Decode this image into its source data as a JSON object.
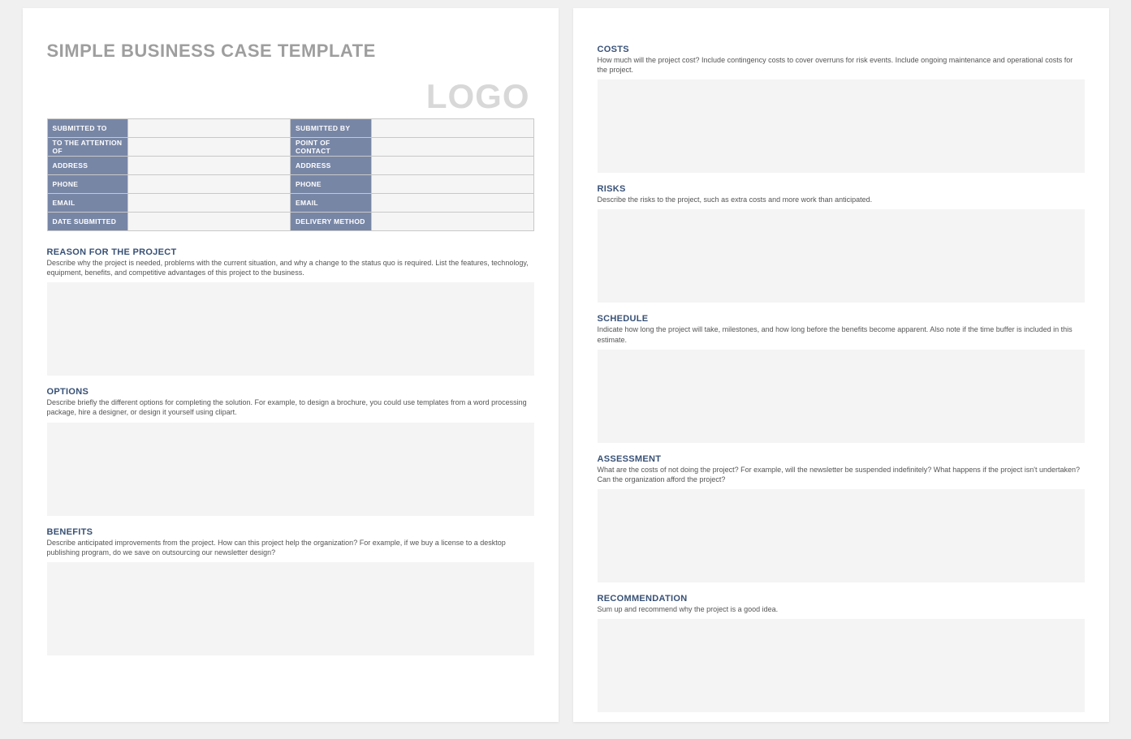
{
  "title": "SIMPLE BUSINESS CASE TEMPLATE",
  "logo": "LOGO",
  "infoTable": {
    "r1c1": "SUBMITTED TO",
    "r1c2": "SUBMITTED BY",
    "r2c1": "TO THE ATTENTION OF",
    "r2c2": "POINT OF CONTACT",
    "r3c1": "ADDRESS",
    "r3c2": "ADDRESS",
    "r4c1": "PHONE",
    "r4c2": "PHONE",
    "r5c1": "EMAIL",
    "r5c2": "EMAIL",
    "r6c1": "DATE SUBMITTED",
    "r6c2": "DELIVERY METHOD"
  },
  "sections": {
    "reason": {
      "title": "REASON FOR THE PROJECT",
      "desc": "Describe why the project is needed, problems with the current situation, and why a change to the status quo is required. List the features, technology, equipment, benefits, and competitive advantages of this project to the business."
    },
    "options": {
      "title": "OPTIONS",
      "desc": "Describe briefly the different options for completing the solution. For example, to design a brochure, you could use templates from a word processing package, hire a designer, or design it yourself using clipart."
    },
    "benefits": {
      "title": "BENEFITS",
      "desc": "Describe anticipated improvements from the project. How can this project help the organization? For example, if we buy a license to a desktop publishing program, do we save on outsourcing our newsletter design?"
    },
    "costs": {
      "title": "COSTS",
      "desc": "How much will the project cost? Include contingency costs to cover overruns for risk events. Include ongoing maintenance and operational costs for the project."
    },
    "risks": {
      "title": "RISKS",
      "desc": "Describe the risks to the project, such as extra costs and more work than anticipated."
    },
    "schedule": {
      "title": "SCHEDULE",
      "desc": "Indicate how long the project will take, milestones, and how long before the benefits become apparent. Also note if the time buffer is included in this estimate."
    },
    "assessment": {
      "title": "ASSESSMENT",
      "desc": "What are the costs of not doing the project? For example, will the newsletter be suspended indefinitely? What happens if the project isn't undertaken? Can the organization afford the project?"
    },
    "recommendation": {
      "title": "RECOMMENDATION",
      "desc": "Sum up and recommend why the project is a good idea."
    }
  }
}
